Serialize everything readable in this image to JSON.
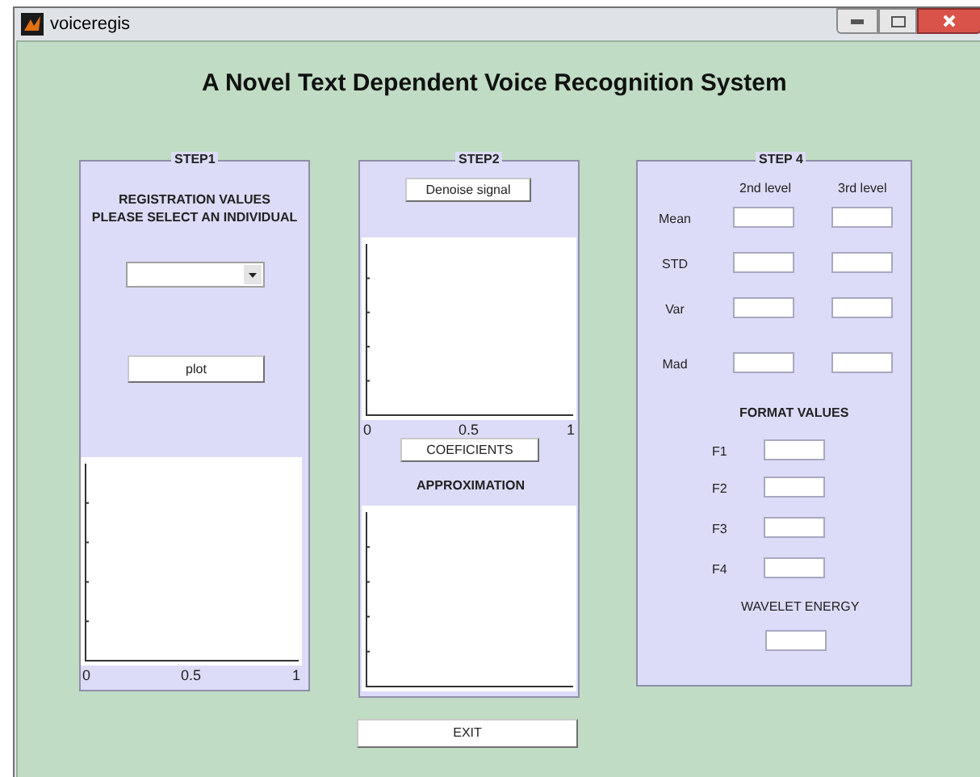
{
  "window": {
    "title": "voiceregis"
  },
  "heading": "A Novel Text Dependent Voice Recognition System",
  "step1": {
    "title": "STEP1",
    "labels": [
      "REGISTRATION VALUES",
      "PLEASE SELECT AN INDIVIDUAL"
    ],
    "plot_button": "plot",
    "axes": {
      "x_ticks": [
        "0",
        "0.5",
        "1"
      ]
    }
  },
  "step2": {
    "title": "STEP2",
    "denoise_button": "Denoise signal",
    "axes": {
      "x_ticks": [
        "0",
        "0.5",
        "1"
      ]
    },
    "coefficients_button": "COEFICIENTS",
    "approximation_label": "APPROXIMATION"
  },
  "step4": {
    "title": "STEP 4",
    "columns": [
      "2nd level",
      "3rd level"
    ],
    "rows": [
      {
        "label": "Mean"
      },
      {
        "label": "STD"
      },
      {
        "label": "Var"
      },
      {
        "label": "Mad"
      }
    ],
    "format_title": "FORMAT VALUES",
    "format_rows": [
      {
        "label": "F1"
      },
      {
        "label": "F2"
      },
      {
        "label": "F3"
      },
      {
        "label": "F4"
      }
    ],
    "energy_label": "WAVELET ENERGY"
  },
  "exit_button": "EXIT"
}
